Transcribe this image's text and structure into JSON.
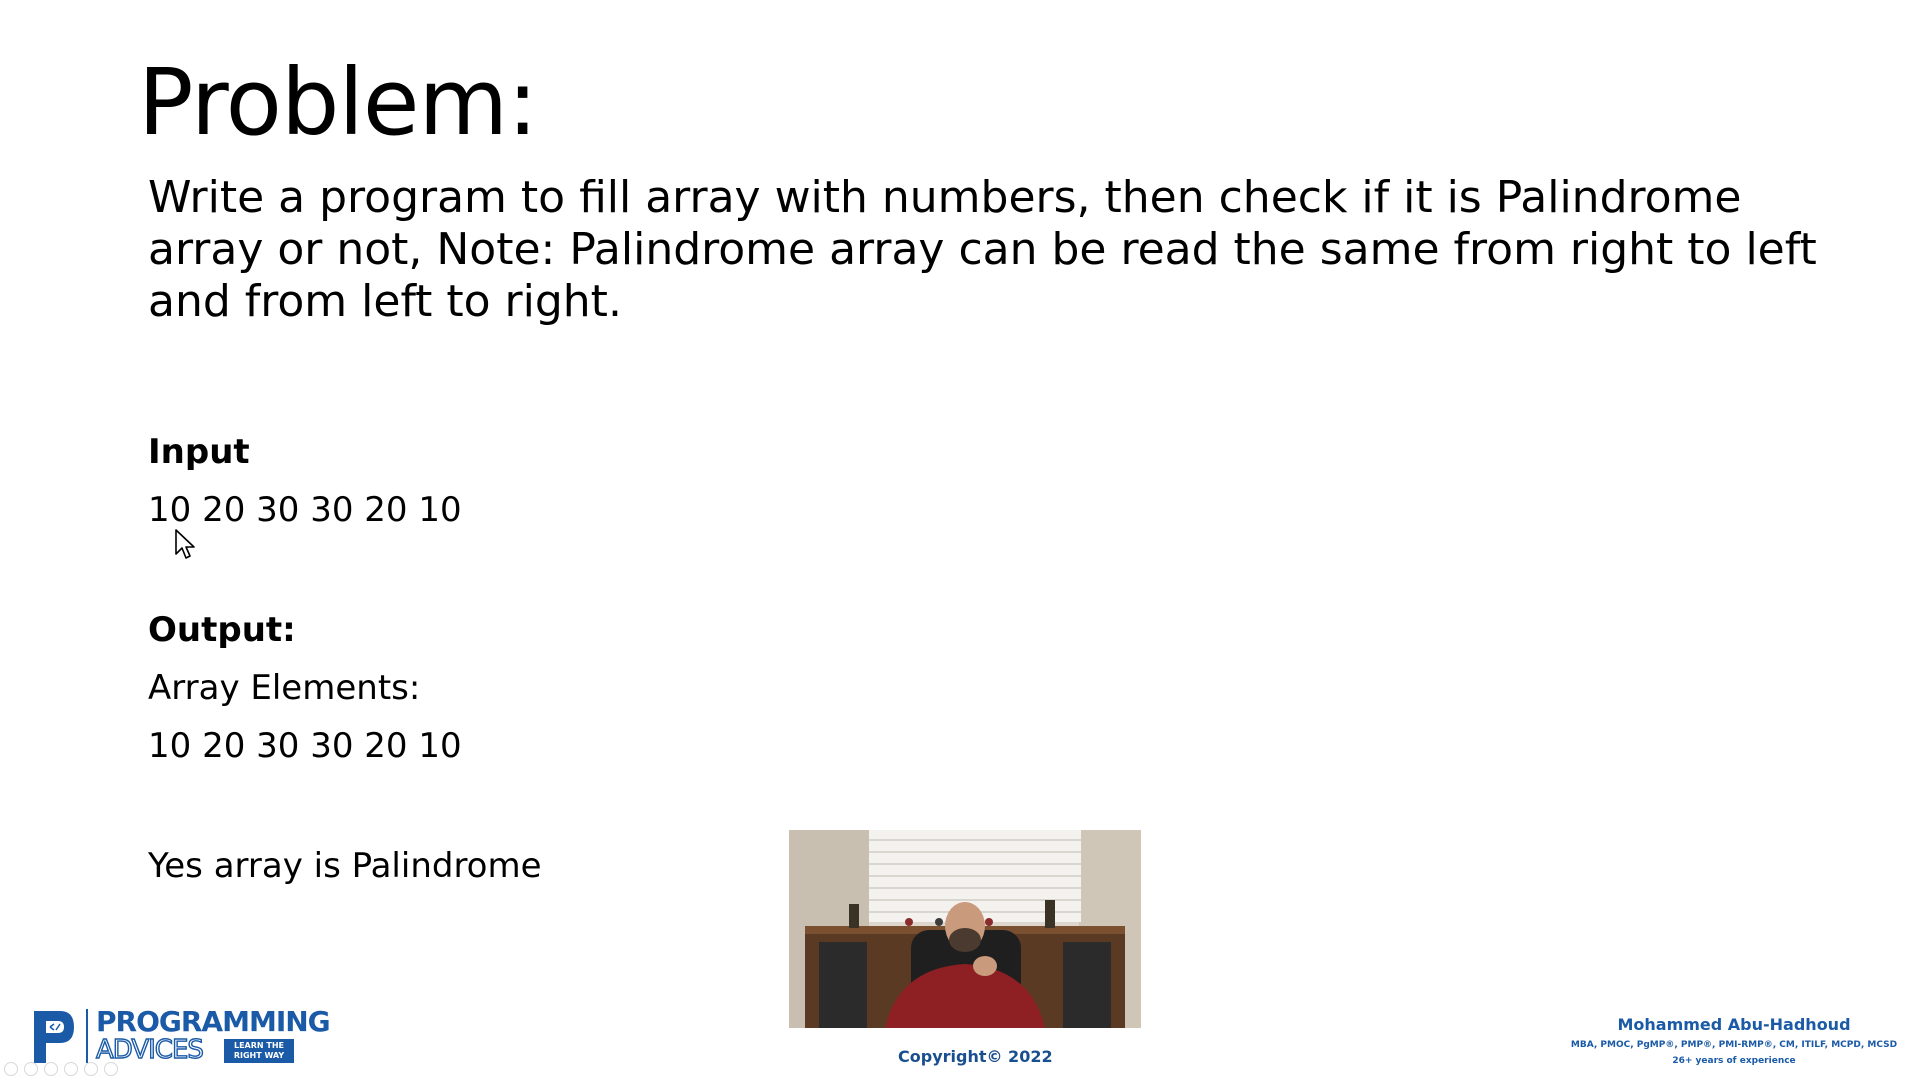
{
  "slide": {
    "title": "Problem:",
    "problem_statement": "Write a program to fill array with numbers, then check if it is Palindrome array or not, Note: Palindrome array can be read the same from right to left and from left to right.",
    "input_label": "Input",
    "input_values": "10 20 30 30 20 10",
    "output_label": "Output:",
    "output_caption": "Array Elements:",
    "output_values": "10 20 30 30 20 10",
    "result_text": "Yes array is Palindrome"
  },
  "footer": {
    "logo_top": "PROGRAMMING",
    "logo_bottom": "ADVICES",
    "logo_badge": "LEARN THE RIGHT WAY",
    "copyright": "Copyright© 2022",
    "author_name": "Mohammed Abu-Hadhoud",
    "author_credentials": "MBA, PMOC, PgMP®, PMP®, PMI-RMP®, CM, ITILF, MCPD, MCSD",
    "author_experience": "26+ years of experience"
  },
  "colors": {
    "brand_blue": "#1a5aa6",
    "text": "#000000",
    "background": "#ffffff"
  }
}
